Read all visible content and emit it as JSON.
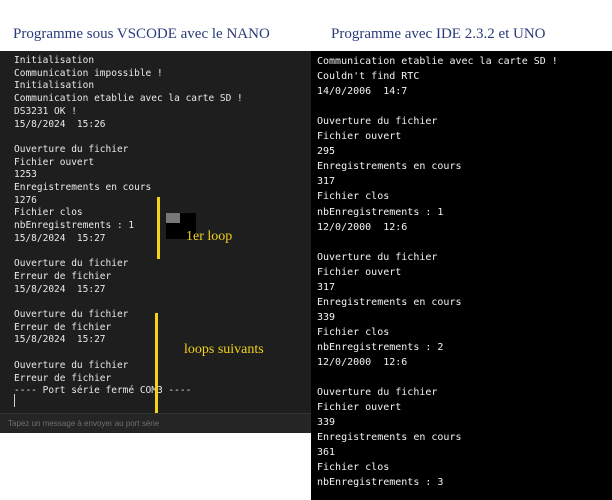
{
  "titles": {
    "left": "Programme sous VSCODE avec le NANO",
    "right": "Programme avec IDE 2.3.2 et UNO"
  },
  "vscode_monitor": {
    "lines": [
      "Initialisation",
      "Communication impossible !",
      "Initialisation",
      "Communication etablie avec la carte SD !",
      "DS3231 OK !",
      "15/8/2024  15:26",
      "",
      "Ouverture du fichier",
      "Fichier ouvert",
      "1253",
      "Enregistrements en cours",
      "1276",
      "Fichier clos",
      "nbEnregistrements : 1",
      "15/8/2024  15:27",
      "",
      "Ouverture du fichier",
      "Erreur de fichier",
      "15/8/2024  15:27",
      "",
      "Ouverture du fichier",
      "Erreur de fichier",
      "15/8/2024  15:27",
      "",
      "Ouverture du fichier",
      "Erreur de fichier",
      "---- Port série fermé COM3 ----"
    ],
    "input_placeholder": "Tapez un message à envoyer au port série",
    "annotations": {
      "first": "1er loop",
      "next": "loops suivants"
    }
  },
  "ide_monitor": {
    "lines": [
      "Communication etablie avec la carte SD !",
      "Couldn't find RTC",
      "14/0/2006  14:7",
      "",
      "Ouverture du fichier",
      "Fichier ouvert",
      "295",
      "Enregistrements en cours",
      "317",
      "Fichier clos",
      "nbEnregistrements : 1",
      "12/0/2000  12:6",
      "",
      "Ouverture du fichier",
      "Fichier ouvert",
      "317",
      "Enregistrements en cours",
      "339",
      "Fichier clos",
      "nbEnregistrements : 2",
      "12/0/2000  12:6",
      "",
      "Ouverture du fichier",
      "Fichier ouvert",
      "339",
      "Enregistrements en cours",
      "361",
      "Fichier clos",
      "nbEnregistrements : 3"
    ]
  },
  "colors": {
    "title": "#2a3a7a",
    "annotation": "#f2d21b",
    "vscode_bg": "#1e1e1e",
    "ide_bg": "#000000"
  }
}
